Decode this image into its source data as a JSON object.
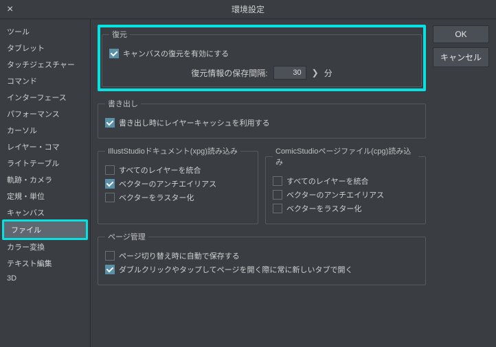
{
  "window": {
    "title": "環境設定"
  },
  "sidebar": {
    "items": [
      {
        "label": "ツール"
      },
      {
        "label": "タブレット"
      },
      {
        "label": "タッチジェスチャー"
      },
      {
        "label": "コマンド"
      },
      {
        "label": "インターフェース"
      },
      {
        "label": "パフォーマンス"
      },
      {
        "label": "カーソル"
      },
      {
        "label": "レイヤー・コマ"
      },
      {
        "label": "ライトテーブル"
      },
      {
        "label": "軌跡・カメラ"
      },
      {
        "label": "定規・単位"
      },
      {
        "label": "キャンバス"
      },
      {
        "label": "ファイル"
      },
      {
        "label": "カラー変換"
      },
      {
        "label": "テキスト編集"
      },
      {
        "label": "3D"
      }
    ],
    "activeIndex": 12
  },
  "buttons": {
    "ok": "OK",
    "cancel": "キャンセル"
  },
  "restore": {
    "legend": "復元",
    "enable": "キャンバスの復元を有効にする",
    "intervalLabel": "復元情報の保存間隔:",
    "intervalValue": "30",
    "intervalUnit": "分"
  },
  "export": {
    "legend": "書き出し",
    "cache": "書き出し時にレイヤーキャッシュを利用する"
  },
  "xpg": {
    "legend": "IllustStudioドキュメント(xpg)読み込み",
    "mergeAll": "すべてのレイヤーを統合",
    "vectorAA": "ベクターのアンチエイリアス",
    "vectorRaster": "ベクターをラスター化"
  },
  "cpg": {
    "legend": "ComicStudioページファイル(cpg)読み込み",
    "mergeAll": "すべてのレイヤーを統合",
    "vectorAA": "ベクターのアンチエイリアス",
    "vectorRaster": "ベクターをラスター化"
  },
  "pageMgmt": {
    "legend": "ページ管理",
    "autosave": "ページ切り替え時に自動で保存する",
    "newTab": "ダブルクリックやタップしてページを開く際に常に新しいタブで開く"
  }
}
